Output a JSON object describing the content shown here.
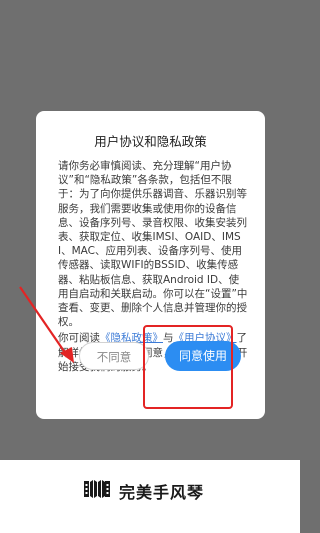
{
  "dialog": {
    "title": "用户协议和隐私政策",
    "paragraph1": "请你务必审慎阅读、充分理解“用户协议”和“隐私政策”各条款，包括但不限于：为了向你提供乐器调音、乐器识别等服务，我们需要收集或使用你的设备信息、设备序列号、录音权限、收集安装列表、获取定位、收集IMSI、OAID、IMSI、MAC、应用列表、设备序列号、使用传感器、读取WIFI的BSSID、收集传感器、粘贴板信息、获取Android ID、使用自启动和关联启动。你可以在“设置”中查看、变更、删除个人信息并管理你的授权。",
    "p2_prefix": "你可阅读",
    "privacy_link": "《隐私政策》",
    "p2_and": "与",
    "user_link": "《用户协议》",
    "p2_suffix": "了解详细信息。如你同意，请点击“同意”开始接受我们的服务。",
    "decline_label": "不同意",
    "accept_label": "同意使用"
  },
  "brand": {
    "logo_icon": "accordion-icon",
    "name": "完美手风琴"
  },
  "annotations": {
    "highlight_color": "#e32424"
  }
}
